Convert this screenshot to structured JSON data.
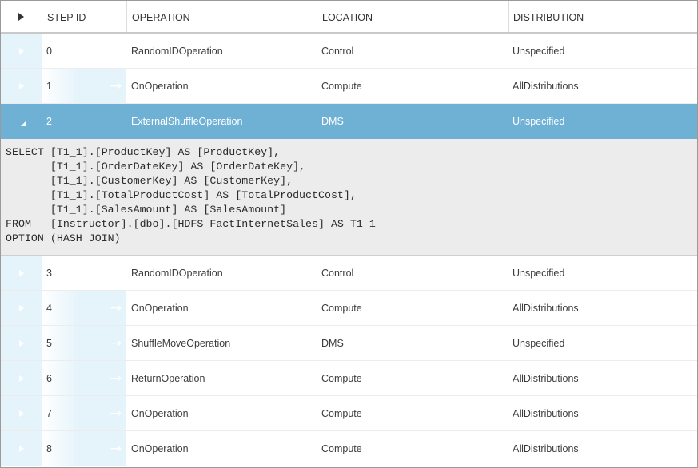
{
  "columns": {
    "step_id": "STEP ID",
    "operation": "OPERATION",
    "location": "LOCATION",
    "distribution": "DISTRIBUTION"
  },
  "rows_before": [
    {
      "step": "0",
      "operation": "RandomIDOperation",
      "location": "Control",
      "distribution": "Unspecified",
      "arrow": false
    },
    {
      "step": "1",
      "operation": "OnOperation",
      "location": "Compute",
      "distribution": "AllDistributions",
      "arrow": true
    }
  ],
  "selected_row": {
    "step": "2",
    "operation": "ExternalShuffleOperation",
    "location": "DMS",
    "distribution": "Unspecified"
  },
  "selected_detail": {
    "sql_lines": [
      "SELECT [T1_1].[ProductKey] AS [ProductKey],",
      "       [T1_1].[OrderDateKey] AS [OrderDateKey],",
      "       [T1_1].[CustomerKey] AS [CustomerKey],",
      "       [T1_1].[TotalProductCost] AS [TotalProductCost],",
      "       [T1_1].[SalesAmount] AS [SalesAmount]",
      "FROM   [Instructor].[dbo].[HDFS_FactInternetSales] AS T1_1",
      "OPTION (HASH JOIN)"
    ]
  },
  "rows_after": [
    {
      "step": "3",
      "operation": "RandomIDOperation",
      "location": "Control",
      "distribution": "Unspecified",
      "arrow": false
    },
    {
      "step": "4",
      "operation": "OnOperation",
      "location": "Compute",
      "distribution": "AllDistributions",
      "arrow": true
    },
    {
      "step": "5",
      "operation": "ShuffleMoveOperation",
      "location": "DMS",
      "distribution": "Unspecified",
      "arrow": true
    },
    {
      "step": "6",
      "operation": "ReturnOperation",
      "location": "Compute",
      "distribution": "AllDistributions",
      "arrow": true
    },
    {
      "step": "7",
      "operation": "OnOperation",
      "location": "Compute",
      "distribution": "AllDistributions",
      "arrow": true
    },
    {
      "step": "8",
      "operation": "OnOperation",
      "location": "Compute",
      "distribution": "AllDistributions",
      "arrow": true
    }
  ],
  "colors": {
    "selected_row_bg": "#6fb0d5",
    "gutter_bg": "#e5f3fb",
    "detail_bg": "#ececec"
  },
  "icons": {
    "expand_all": "triangle-right-icon",
    "row_expand": "triangle-right-icon",
    "row_collapse": "triangle-down-icon",
    "child_step": "arrow-right-icon"
  }
}
